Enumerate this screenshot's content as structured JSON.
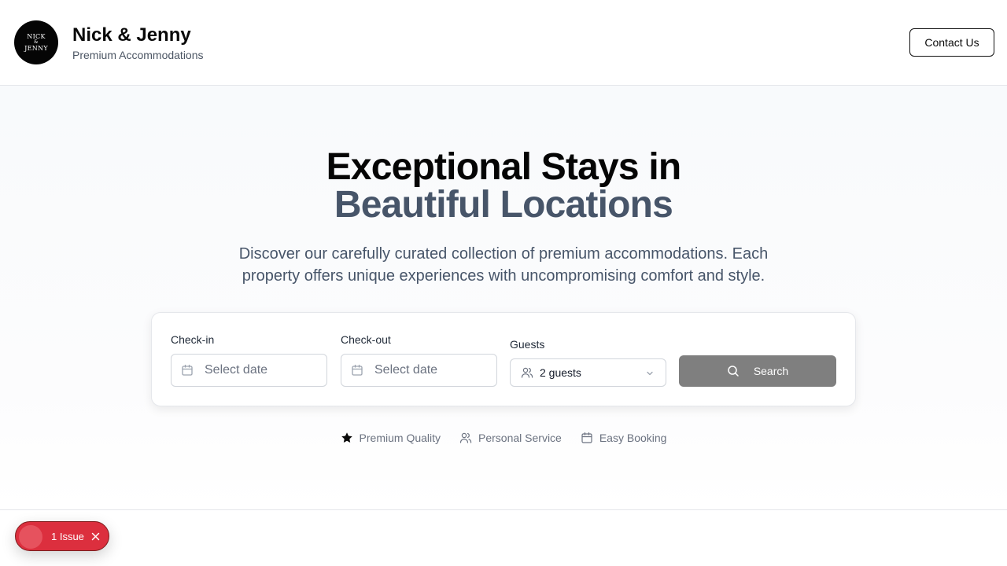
{
  "header": {
    "logo_line1": "NICK",
    "logo_amp": "&",
    "logo_line2": "JENNY",
    "brand_name": "Nick & Jenny",
    "brand_tagline": "Premium Accommodations",
    "contact_label": "Contact Us"
  },
  "hero": {
    "title_line1": "Exceptional Stays in",
    "title_line2": "Beautiful Locations",
    "description": "Discover our carefully curated collection of premium accommodations. Each property offers unique experiences with uncompromising comfort and style."
  },
  "search": {
    "checkin_label": "Check-in",
    "checkin_placeholder": "Select date",
    "checkout_label": "Check-out",
    "checkout_placeholder": "Select date",
    "guests_label": "Guests",
    "guests_value": "2 guests",
    "search_label": "Search"
  },
  "features": [
    {
      "label": "Premium Quality",
      "icon": "star-icon"
    },
    {
      "label": "Personal Service",
      "icon": "users-icon"
    },
    {
      "label": "Easy Booking",
      "icon": "calendar-icon"
    }
  ],
  "issue_badge": {
    "label": "1 Issue"
  },
  "colors": {
    "accent_dark": "#050505",
    "title_secondary": "#475569",
    "search_button": "#7f7f7f",
    "issue_red": "#dc2f3e"
  }
}
